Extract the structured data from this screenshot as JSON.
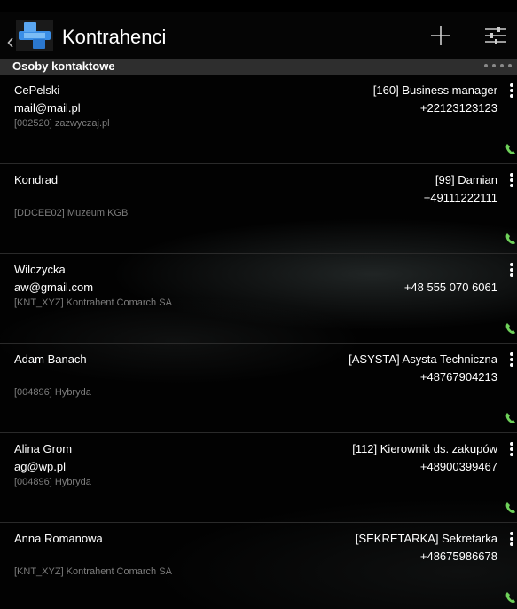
{
  "header": {
    "title": "Kontrahenci",
    "back_icon": "chevron-left-icon",
    "logo_icon": "app-logo-icon",
    "add_icon": "plus-icon",
    "filter_icon": "sliders-icon"
  },
  "section": {
    "title": "Osoby kontaktowe"
  },
  "colors": {
    "accent": "#3a8ee6",
    "call": "#6fd15a",
    "section_bg": "#2e2e2e",
    "secondary_text": "#7d7d7d"
  },
  "contacts": [
    {
      "name": "CePelski",
      "email": "mail@mail.pl",
      "company": "[002520] zazwyczaj.pl",
      "role": "[160] Business manager",
      "phone": "+22123123123"
    },
    {
      "name": "Kondrad",
      "email": "",
      "company": "[DDCEE02] Muzeum KGB",
      "role": "[99] Damian",
      "phone": "+49111222111"
    },
    {
      "name": "Wilczycka",
      "email": "aw@gmail.com",
      "company": "[KNT_XYZ] Kontrahent Comarch SA",
      "role": "",
      "phone": "+48 555 070 6061"
    },
    {
      "name": "Adam Banach",
      "email": "",
      "company": "[004896] Hybryda",
      "role": "[ASYSTA] Asysta Techniczna",
      "phone": "+48767904213"
    },
    {
      "name": "Alina Grom",
      "email": "ag@wp.pl",
      "company": "[004896] Hybryda",
      "role": "[112] Kierownik ds. zakupów",
      "phone": "+48900399467"
    },
    {
      "name": "Anna Romanowa",
      "email": "",
      "company": "[KNT_XYZ] Kontrahent Comarch SA",
      "role": "[SEKRETARKA] Sekretarka",
      "phone": "+48675986678"
    }
  ]
}
